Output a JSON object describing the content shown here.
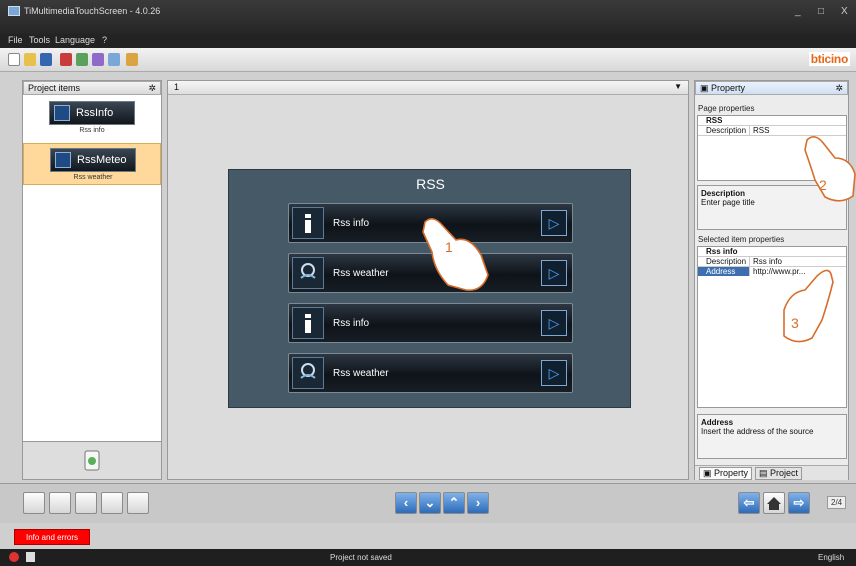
{
  "window": {
    "title": "TiMultimediaTouchScreen - 4.0.26",
    "min": "_",
    "max": "□",
    "close": "X"
  },
  "menu": [
    "File",
    "Tools",
    "Language",
    "?"
  ],
  "brand": "bticino",
  "left_panel": {
    "title": "Project items",
    "pin": "✲",
    "items": [
      {
        "thumb": "RssInfo",
        "sub": "Rss info",
        "icon": "info-icon"
      },
      {
        "thumb": "RssMeteo",
        "sub": "Rss weather",
        "icon": "weather-icon"
      }
    ]
  },
  "center": {
    "page_tab": "1",
    "canvas_title": "RSS",
    "buttons": [
      {
        "label": "Rss info",
        "icon": "info-icon"
      },
      {
        "label": "Rss weather",
        "icon": "weather-icon"
      },
      {
        "label": "Rss info",
        "icon": "info-icon"
      },
      {
        "label": "Rss weather",
        "icon": "weather-icon"
      }
    ]
  },
  "right_panel": {
    "title": "Property",
    "page_properties": "Page properties",
    "page_group": "RSS",
    "page_desc_key": "Description",
    "page_desc_val": "RSS",
    "desc_title": "Description",
    "desc_text": "Enter page title",
    "selected_title": "Selected item properties",
    "item_group": "Rss info",
    "item_desc_key": "Description",
    "item_desc_val": "Rss info",
    "item_addr_key": "Address",
    "item_addr_val": "http://www.pr...",
    "addr_title": "Address",
    "addr_text": "Insert the address of the source",
    "tab_property": "Property",
    "tab_project": "Project"
  },
  "page_counter": "2/4",
  "info_button": "Info and errors",
  "status": {
    "text": "Project not saved",
    "language": "English"
  },
  "callouts": [
    "1",
    "2",
    "3"
  ],
  "colors": {
    "accent": "#d86d2a",
    "error": "#ff0000"
  }
}
